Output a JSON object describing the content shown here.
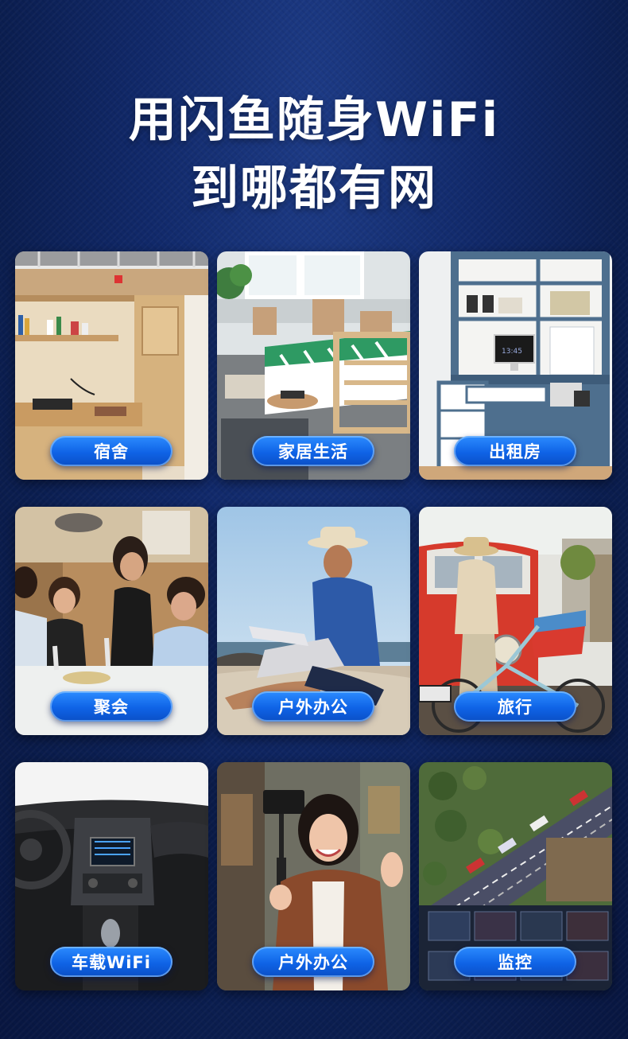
{
  "headline": {
    "line1": "用闪鱼随身WiFi",
    "line2": "到哪都有网"
  },
  "scenes": [
    {
      "label": "宿舍",
      "icon": "dormitory-photo"
    },
    {
      "label": "家居生活",
      "icon": "home-bedroom-photo"
    },
    {
      "label": "出租房",
      "icon": "rental-desk-photo"
    },
    {
      "label": "聚会",
      "icon": "party-photo"
    },
    {
      "label": "户外办公",
      "icon": "beach-laptop-photo"
    },
    {
      "label": "旅行",
      "icon": "travel-bicycle-photo"
    },
    {
      "label": "车载WiFi",
      "icon": "car-dashboard-photo"
    },
    {
      "label": "户外办公",
      "icon": "vlogger-photo"
    },
    {
      "label": "监控",
      "icon": "surveillance-road-photo"
    }
  ],
  "desk_clock": "13:45",
  "colors": {
    "background": "#0c1f52",
    "pill": "#1570f0",
    "text": "#ffffff"
  }
}
